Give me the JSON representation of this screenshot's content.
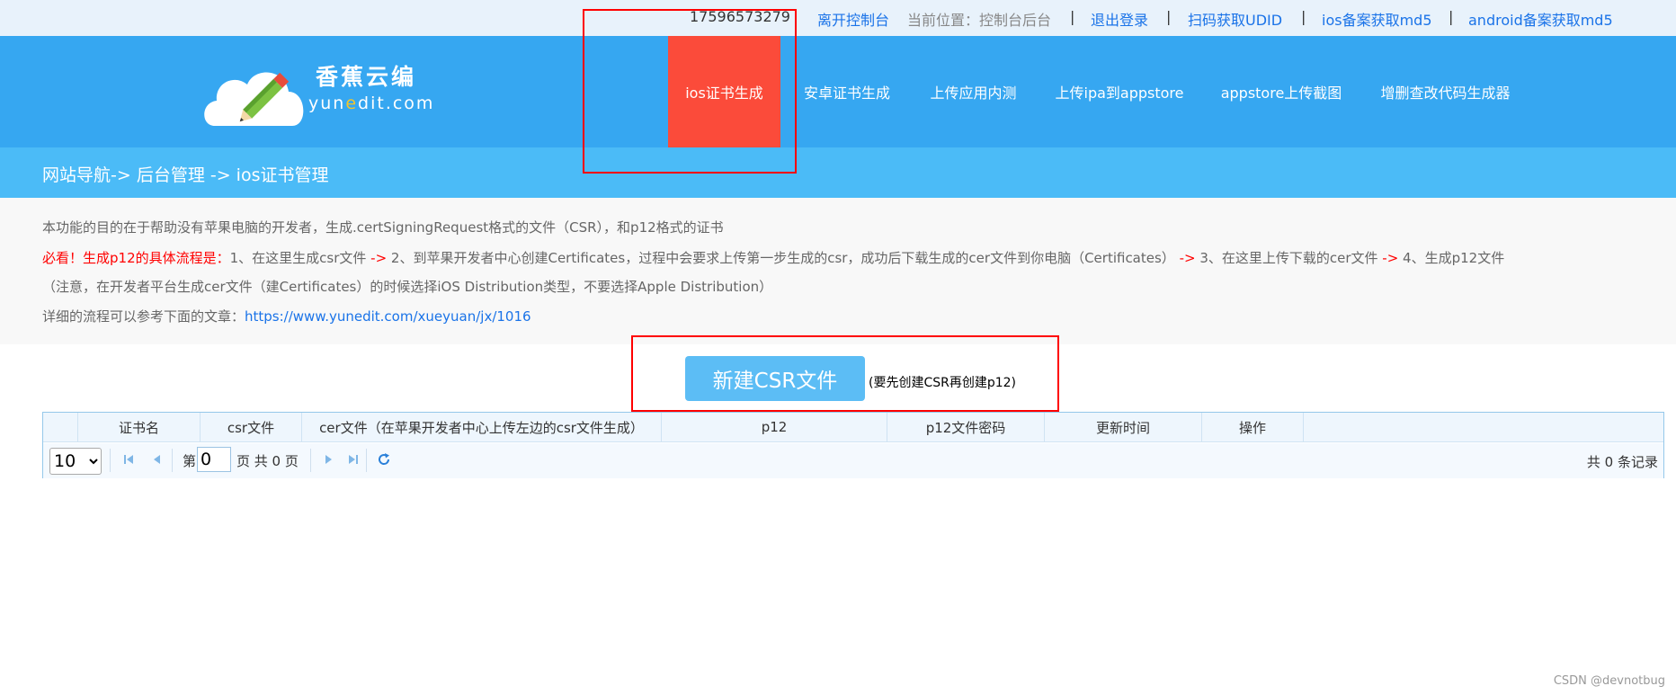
{
  "topbar": {
    "phone": "17596573279",
    "leave_console": "离开控制台",
    "current_position": "当前位置：控制台后台",
    "logout": "退出登录",
    "scan_udid": "扫码获取UDID",
    "ios_md5": "ios备案获取md5",
    "android_md5": "android备案获取md5",
    "separator": "|"
  },
  "logo": {
    "cn": "香蕉云编",
    "en_part1": "yun",
    "en_dot": "e",
    "en_part2": "dit.com"
  },
  "nav": [
    {
      "label": "ios证书生成",
      "active": true
    },
    {
      "label": "安卓证书生成"
    },
    {
      "label": "上传应用内测"
    },
    {
      "label": "上传ipa到appstore"
    },
    {
      "label": "appstore上传截图"
    },
    {
      "label": "增删查改代码生成器"
    }
  ],
  "breadcrumb": "网站导航-> 后台管理 -> ios证书管理",
  "info": {
    "line1": "本功能的目的在于帮助没有苹果电脑的开发者，生成.certSigningRequest格式的文件（CSR），和p12格式的证书",
    "must_see": "必看！生成p12的具体流程是：",
    "step1": "1、在这里生成csr文件 ",
    "arrow": "->",
    "step2": " 2、到苹果开发者中心创建Certificates，过程中会要求上传第一步生成的csr，成功后下载生成的cer文件到你电脑（Certificates） ",
    "step3": " 3、在这里上传下载的cer文件 ",
    "step4": " 4、生成p12文件",
    "line3": "（注意，在开发者平台生成cer文件（建Certificates）的时候选择iOS Distribution类型，不要选择Apple Distribution）",
    "line4_label": "详细的流程可以参考下面的文章：",
    "line4_url": "https://www.yunedit.com/xueyuan/jx/1016"
  },
  "action": {
    "button": "新建CSR文件",
    "note": "(要先创建CSR再创建p12)"
  },
  "table": {
    "columns": [
      "证书名",
      "csr文件",
      "cer文件（在苹果开发者中心上传左边的csr文件生成）",
      "p12",
      "p12文件密码",
      "更新时间",
      "操作"
    ]
  },
  "pager": {
    "page_size": "10",
    "page_label_pre": "第",
    "page_value": "0",
    "page_label_post": "页 共 0 页",
    "total": "共 0 条记录"
  },
  "watermark": "CSDN @devnotbug",
  "colors": {
    "header": "#36a7f1",
    "active_nav": "#fb4b3a",
    "breadcrumb": "#4bbbf7",
    "button": "#5cbdf5",
    "link": "#1a73e8",
    "annotation": "#ff0000"
  }
}
